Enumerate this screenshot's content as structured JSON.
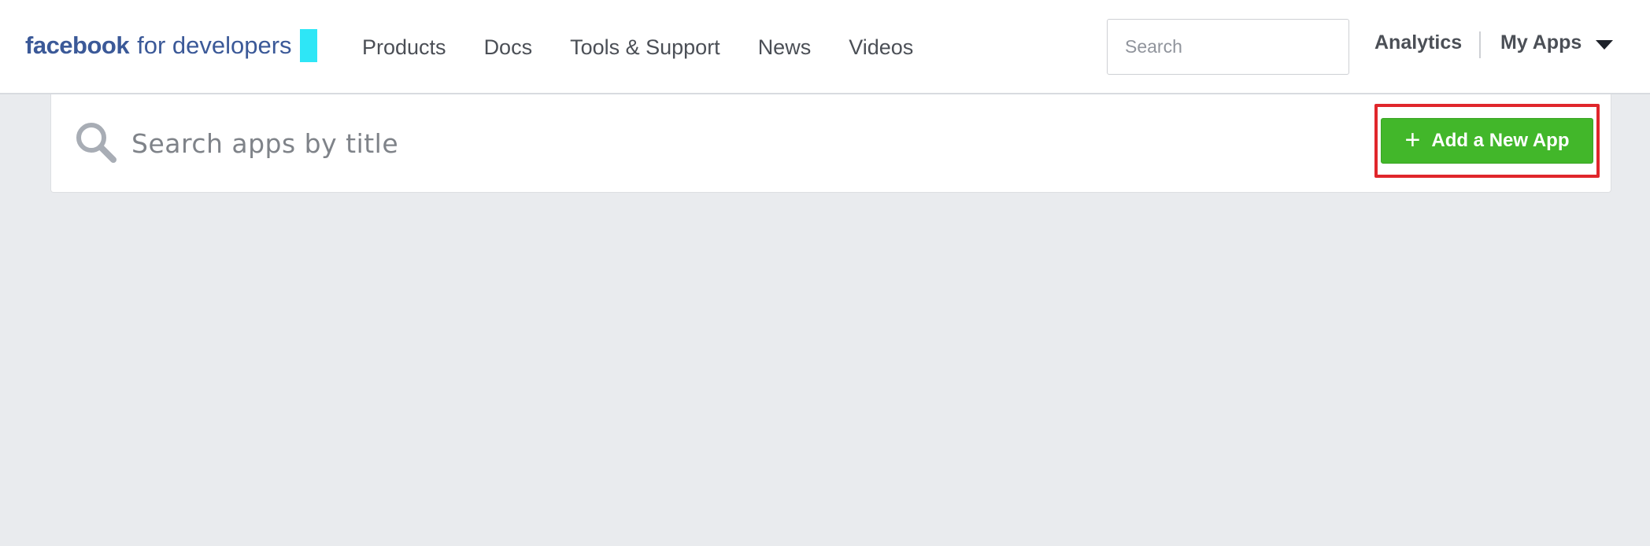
{
  "header": {
    "logo": {
      "brand": "facebook",
      "sub": "for developers",
      "brand_color": "#3b5998",
      "mark_color": "#2ee6f6"
    },
    "nav": [
      {
        "label": "Products"
      },
      {
        "label": "Docs"
      },
      {
        "label": "Tools & Support"
      },
      {
        "label": "News"
      },
      {
        "label": "Videos"
      }
    ],
    "search": {
      "placeholder": "Search",
      "icon": "search-icon"
    },
    "analytics_label": "Analytics",
    "my_apps_label": "My Apps",
    "my_apps_icon": "caret-down-icon"
  },
  "apps_panel": {
    "search": {
      "placeholder": "Search apps by title",
      "icon": "search-icon"
    },
    "add_button": {
      "icon": "plus-icon",
      "label": "Add a New App",
      "color": "#42b72a",
      "highlight_color": "#e0262b"
    }
  },
  "page_background": "#e9ebee"
}
